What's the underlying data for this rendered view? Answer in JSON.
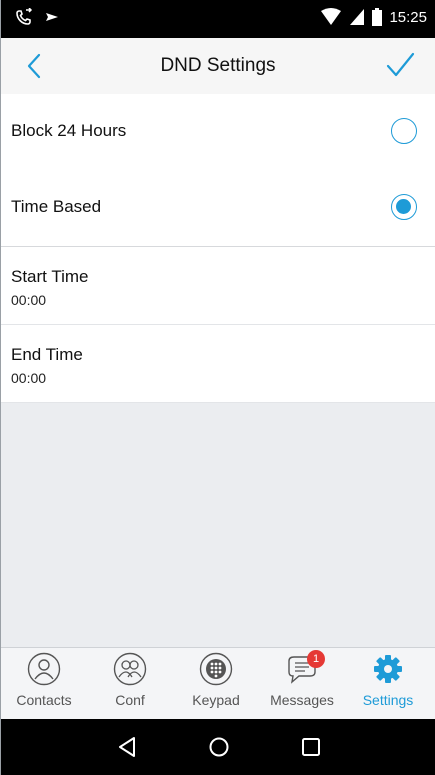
{
  "status_bar": {
    "time": "15:25"
  },
  "header": {
    "title": "DND Settings"
  },
  "options": [
    {
      "label": "Block 24 Hours",
      "selected": false
    },
    {
      "label": "Time Based",
      "selected": true
    }
  ],
  "time_settings": [
    {
      "label": "Start Time",
      "value": "00:00"
    },
    {
      "label": "End Time",
      "value": "00:00"
    }
  ],
  "bottom_nav": {
    "items": [
      {
        "label": "Contacts",
        "icon": "contact-icon"
      },
      {
        "label": "Conf",
        "icon": "conference-icon"
      },
      {
        "label": "Keypad",
        "icon": "keypad-icon"
      },
      {
        "label": "Messages",
        "icon": "message-icon",
        "badge": "1"
      },
      {
        "label": "Settings",
        "icon": "gear-icon",
        "active": true
      }
    ]
  },
  "colors": {
    "accent": "#1e9bd7",
    "badge": "#e53935"
  }
}
